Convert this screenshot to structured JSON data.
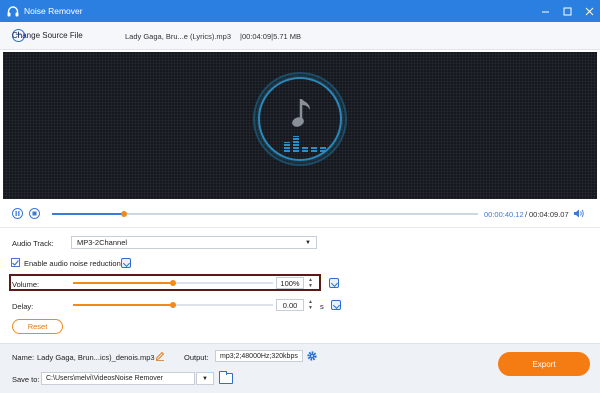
{
  "window": {
    "title": "Noise Remover",
    "controls": [
      "minimize",
      "maximize",
      "close"
    ]
  },
  "filebar": {
    "change_source_label": "Change Source File",
    "file_name": "Lady Gaga, Bru...e (Lyrics).mp3",
    "file_info": "|00:04:09|5.71 MB"
  },
  "player": {
    "progress_fraction": 0.17,
    "current_time": "00:00:40.12",
    "total_time": "00:04:09.07",
    "time_separator": "/"
  },
  "settings": {
    "audio_track_label": "Audio Track:",
    "audio_track_value": "MP3-2Channel",
    "noise_reduction_label": "Enable audio noise reduction",
    "noise_reduction_checked": true,
    "volume_label": "Volume:",
    "volume_value": "100%",
    "volume_fraction": 0.5,
    "delay_label": "Delay:",
    "delay_value": "0.00",
    "delay_unit": "s",
    "delay_fraction": 0.5,
    "reset_label": "Reset"
  },
  "bottom": {
    "name_label": "Name:",
    "name_value": "Lady Gaga, Brun...ics)_denois.mp3",
    "output_label": "Output:",
    "output_value": "mp3;2;48000Hz;320kbps",
    "save_to_label": "Save to:",
    "save_to_value": "C:\\Users\\melvi\\VideosNoise Remover",
    "export_label": "Export"
  },
  "colors": {
    "titlebar": "#2a7fe0",
    "accent_blue": "#3b7ad8",
    "accent_orange": "#f57c12",
    "highlight_border": "#5a1a1a"
  }
}
